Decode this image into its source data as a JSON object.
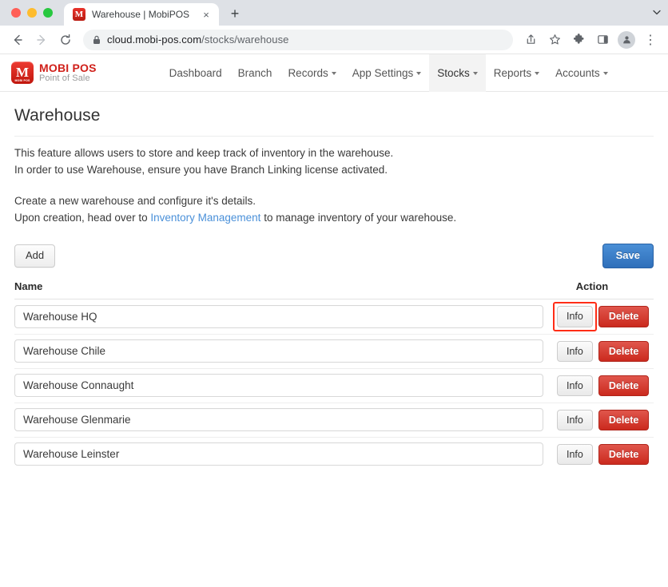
{
  "browser": {
    "tab": {
      "title": "Warehouse | MobiPOS",
      "favicon": "mobipos-favicon",
      "close_label": "×"
    },
    "new_tab_label": "+",
    "tab_list_label": "⌄",
    "nav": {
      "back_label": "←",
      "forward_label": "→",
      "reload_label": "⟳"
    },
    "omnibox": {
      "lock": "lock-icon",
      "domain": "cloud.mobi-pos.com",
      "path": "/stocks/warehouse"
    },
    "actions": {
      "share_label": "share-icon",
      "bookmark_label": "☆",
      "extensions_label": "extensions-icon",
      "sidepanel_label": "sidepanel-icon",
      "profile_label": "profile-avatar",
      "menu_label": "⋮"
    }
  },
  "app": {
    "brand": {
      "mark_letter": "M",
      "mark_tiny": "MOBI POS",
      "title": "MOBI POS",
      "subtitle": "Point of Sale",
      "color": "#d0201a"
    },
    "nav_items": [
      {
        "label": "Dashboard",
        "has_caret": false,
        "active": false
      },
      {
        "label": "Branch",
        "has_caret": false,
        "active": false
      },
      {
        "label": "Records",
        "has_caret": true,
        "active": false
      },
      {
        "label": "App Settings",
        "has_caret": true,
        "active": false
      },
      {
        "label": "Stocks",
        "has_caret": true,
        "active": true
      },
      {
        "label": "Reports",
        "has_caret": true,
        "active": false
      },
      {
        "label": "Accounts",
        "has_caret": true,
        "active": false
      }
    ]
  },
  "main": {
    "title": "Warehouse",
    "description": {
      "line1": "This feature allows users to store and keep track of inventory in the warehouse.",
      "line2": "In order to use Warehouse, ensure you have Branch Linking license activated.",
      "line3": "Create a new warehouse and configure it's details.",
      "line4_prefix": "Upon creation, head over to ",
      "line4_link": "Inventory Management",
      "line4_suffix": " to manage inventory of your warehouse."
    },
    "add_label": "Add",
    "save_label": "Save",
    "columns": {
      "name": "Name",
      "action": "Action"
    },
    "rows": [
      {
        "name": "Warehouse HQ",
        "info_label": "Info",
        "delete_label": "Delete",
        "highlighted": true
      },
      {
        "name": "Warehouse Chile",
        "info_label": "Info",
        "delete_label": "Delete",
        "highlighted": false
      },
      {
        "name": "Warehouse Connaught",
        "info_label": "Info",
        "delete_label": "Delete",
        "highlighted": false
      },
      {
        "name": "Warehouse Glenmarie",
        "info_label": "Info",
        "delete_label": "Delete",
        "highlighted": false
      },
      {
        "name": "Warehouse Leinster",
        "info_label": "Info",
        "delete_label": "Delete",
        "highlighted": false
      }
    ],
    "highlight_color": "#ff2d16"
  }
}
